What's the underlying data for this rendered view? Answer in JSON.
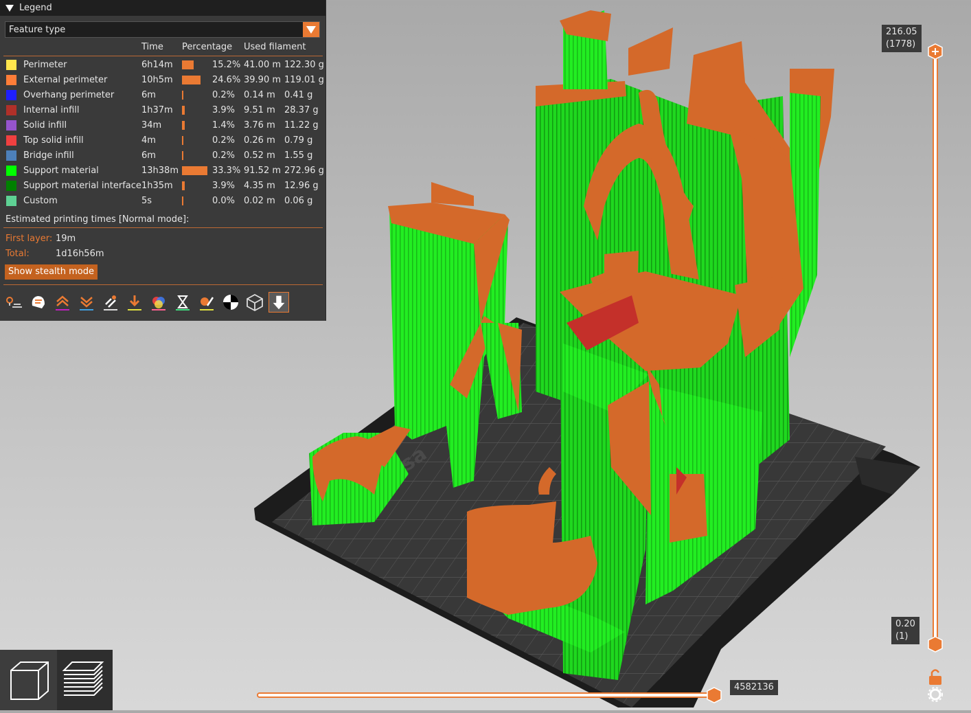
{
  "legend": {
    "title": "Legend",
    "view_type": "Feature type",
    "headers": {
      "time": "Time",
      "percentage": "Percentage",
      "filament": "Used filament"
    },
    "rows": [
      {
        "label": "Perimeter",
        "color": "#ffe64d",
        "time": "6h14m",
        "pct_value": 15.2,
        "pct": "15.2%",
        "length": "41.00 m",
        "weight": "122.30 g"
      },
      {
        "label": "External perimeter",
        "color": "#ff7d38",
        "time": "10h5m",
        "pct_value": 24.6,
        "pct": "24.6%",
        "length": "39.90 m",
        "weight": "119.01 g"
      },
      {
        "label": "Overhang perimeter",
        "color": "#1f1fff",
        "time": "6m",
        "pct_value": 0.2,
        "pct": "0.2%",
        "length": "0.14 m",
        "weight": "0.41 g"
      },
      {
        "label": "Internal infill",
        "color": "#b03029",
        "time": "1h37m",
        "pct_value": 3.9,
        "pct": "3.9%",
        "length": "9.51 m",
        "weight": "28.37 g"
      },
      {
        "label": "Solid infill",
        "color": "#9654cc",
        "time": "34m",
        "pct_value": 1.4,
        "pct": "1.4%",
        "length": "3.76 m",
        "weight": "11.22 g"
      },
      {
        "label": "Top solid infill",
        "color": "#f04040",
        "time": "4m",
        "pct_value": 0.2,
        "pct": "0.2%",
        "length": "0.26 m",
        "weight": "0.79 g"
      },
      {
        "label": "Bridge infill",
        "color": "#4d80ba",
        "time": "6m",
        "pct_value": 0.2,
        "pct": "0.2%",
        "length": "0.52 m",
        "weight": "1.55 g"
      },
      {
        "label": "Support material",
        "color": "#00ff00",
        "time": "13h38m",
        "pct_value": 33.3,
        "pct": "33.3%",
        "length": "91.52 m",
        "weight": "272.96 g"
      },
      {
        "label": "Support material interface",
        "color": "#008000",
        "time": "1h35m",
        "pct_value": 3.9,
        "pct": "3.9%",
        "length": "4.35 m",
        "weight": "12.96 g"
      },
      {
        "label": "Custom",
        "color": "#5ed194",
        "time": "5s",
        "pct_value": 0.0,
        "pct": "0.0%",
        "length": "0.02 m",
        "weight": "0.06 g"
      }
    ],
    "estimated_title": "Estimated printing times [Normal mode]:",
    "first_layer_label": "First layer:",
    "first_layer_value": "19m",
    "total_label": "Total:",
    "total_value": "1d16h56m",
    "stealth_button": "Show stealth mode",
    "toolbar_icons": [
      "travel-icon",
      "wipe-icon",
      "retractions-icon",
      "deretractions-icon",
      "seams-icon",
      "tool-changes-icon",
      "color-changes-icon",
      "pause-prints-icon",
      "custom-gcode-icon",
      "center-of-gravity-icon",
      "shells-icon",
      "tool-marker-icon"
    ]
  },
  "vertical_slider": {
    "top_value": "216.05",
    "top_layer": "(1778)",
    "bottom_value": "0.20",
    "bottom_layer": "(1)"
  },
  "horizontal_slider": {
    "value": "4582136",
    "position": 0.98
  },
  "bed_text": "prusa",
  "colors": {
    "accent": "#ea7a33",
    "support": "#00ff00",
    "perimeter": "#d4692a"
  }
}
